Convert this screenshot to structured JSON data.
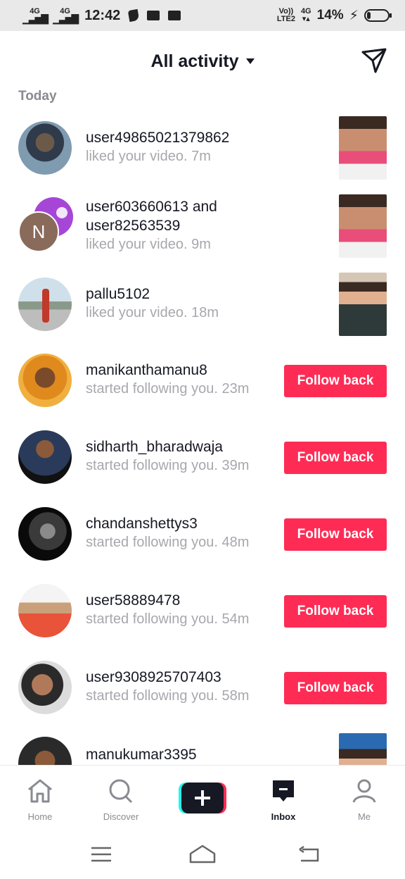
{
  "status_bar": {
    "net1": "4G",
    "net2": "4G",
    "time": "12:42",
    "volte": "Vo))",
    "lte": "LTE2",
    "sim_net": "4G",
    "battery": "14%"
  },
  "header": {
    "title": "All activity"
  },
  "section": {
    "today": "Today"
  },
  "activities": [
    {
      "username": "user49865021379862",
      "text": "liked your video.",
      "time": "7m"
    },
    {
      "username": "user603660613",
      "and": "and",
      "username2": "user82563539",
      "text": "liked your video.",
      "time": "9m",
      "avatar_letter": "N"
    },
    {
      "username": "pallu5102",
      "text": "liked your video.",
      "time": "18m"
    },
    {
      "username": "manikanthamanu8",
      "text": "started following you.",
      "time": "23m",
      "button": "Follow back"
    },
    {
      "username": "sidharth_bharadwaja",
      "text": "started following you.",
      "time": "39m",
      "button": "Follow back"
    },
    {
      "username": "chandanshettys3",
      "text": "started following you.",
      "time": "48m",
      "button": "Follow back"
    },
    {
      "username": "user58889478",
      "text": "started following you.",
      "time": "54m",
      "button": "Follow back"
    },
    {
      "username": "user9308925707403",
      "text": "started following you.",
      "time": "58m",
      "button": "Follow back"
    },
    {
      "username": "manukumar3395"
    }
  ],
  "nav": {
    "home": "Home",
    "discover": "Discover",
    "inbox": "Inbox",
    "me": "Me"
  },
  "colors": {
    "accent": "#fe2c55",
    "text": "#161823",
    "muted": "#a7a8ad"
  }
}
